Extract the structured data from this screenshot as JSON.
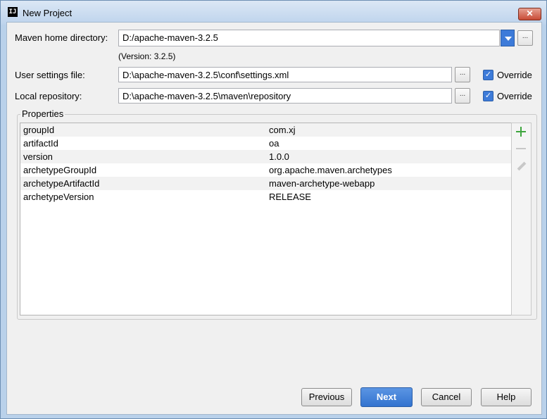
{
  "window": {
    "title": "New Project",
    "icon_text": "IJ",
    "close_glyph": "✕"
  },
  "form": {
    "maven_home": {
      "label": "Maven home directory:",
      "value": "D:/apache-maven-3.2.5",
      "version_text": "(Version: 3.2.5)",
      "browse_glyph": "..."
    },
    "user_settings": {
      "label": "User settings file:",
      "value": "D:\\apache-maven-3.2.5\\conf\\settings.xml",
      "browse_glyph": "...",
      "override_label": "Override",
      "override_checked": true
    },
    "local_repository": {
      "label": "Local repository:",
      "value": "D:\\apache-maven-3.2.5\\maven\\repository",
      "browse_glyph": "...",
      "override_label": "Override",
      "override_checked": true
    }
  },
  "properties": {
    "label": "Properties",
    "rows": [
      {
        "key": "groupId",
        "value": "com.xj"
      },
      {
        "key": "artifactId",
        "value": "oa"
      },
      {
        "key": "version",
        "value": "1.0.0"
      },
      {
        "key": "archetypeGroupId",
        "value": "org.apache.maven.archetypes"
      },
      {
        "key": "archetypeArtifactId",
        "value": "maven-archetype-webapp"
      },
      {
        "key": "archetypeVersion",
        "value": "RELEASE"
      }
    ],
    "icons": [
      "add-icon",
      "remove-icon",
      "edit-icon"
    ]
  },
  "buttons": {
    "previous": "Previous",
    "next": "Next",
    "cancel": "Cancel",
    "help": "Help"
  },
  "colors": {
    "accent": "#3d7bd9",
    "add_icon": "#3da53d"
  }
}
